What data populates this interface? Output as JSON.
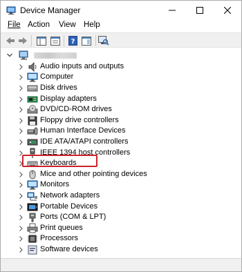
{
  "window": {
    "title": "Device Manager"
  },
  "menu": {
    "file": "File",
    "action": "Action",
    "view": "View",
    "help": "Help"
  },
  "tree": {
    "items": [
      {
        "label": "Audio inputs and outputs",
        "icon": "speaker-icon"
      },
      {
        "label": "Computer",
        "icon": "monitor-icon"
      },
      {
        "label": "Disk drives",
        "icon": "disk-drive-icon"
      },
      {
        "label": "Display adapters",
        "icon": "display-adapter-icon"
      },
      {
        "label": "DVD/CD-ROM drives",
        "icon": "dvd-drive-icon"
      },
      {
        "label": "Floppy drive controllers",
        "icon": "floppy-controller-icon"
      },
      {
        "label": "Human Interface Devices",
        "icon": "hid-icon"
      },
      {
        "label": "IDE ATA/ATAPI controllers",
        "icon": "ide-controller-icon"
      },
      {
        "label": "IEEE 1394 host controllers",
        "icon": "ieee1394-icon"
      },
      {
        "label": "Keyboards",
        "icon": "keyboard-icon"
      },
      {
        "label": "Mice and other pointing devices",
        "icon": "mouse-icon"
      },
      {
        "label": "Monitors",
        "icon": "monitor-icon"
      },
      {
        "label": "Network adapters",
        "icon": "network-adapter-icon"
      },
      {
        "label": "Portable Devices",
        "icon": "portable-device-icon"
      },
      {
        "label": "Ports (COM & LPT)",
        "icon": "port-icon"
      },
      {
        "label": "Print queues",
        "icon": "printer-icon"
      },
      {
        "label": "Processors",
        "icon": "processor-icon"
      },
      {
        "label": "Software devices",
        "icon": "software-device-icon"
      }
    ]
  },
  "colors": {
    "highlight": "#d0202a",
    "toolbar_bg": "#f0f0f0",
    "icon_blue": "#1e73be"
  }
}
